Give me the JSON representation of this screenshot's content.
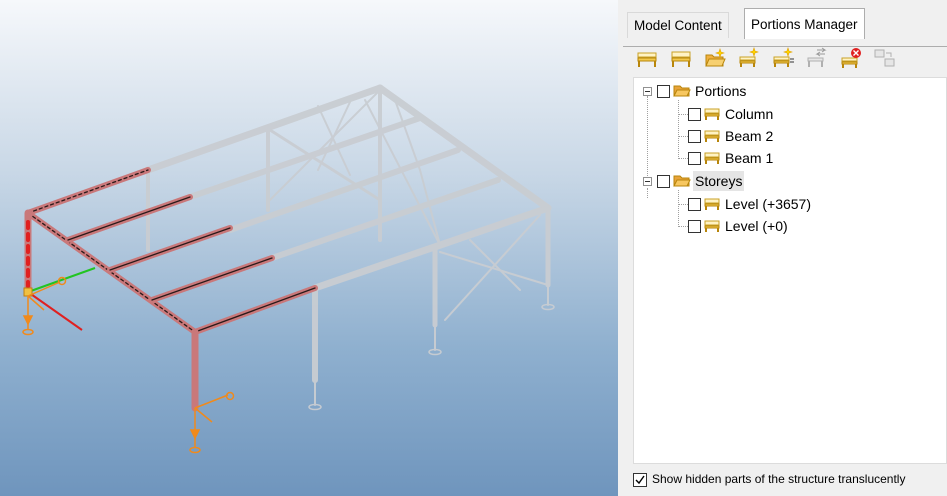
{
  "panel": {
    "tabs": [
      {
        "label": "Model Content",
        "active": false
      },
      {
        "label": "Portions Manager",
        "active": true
      }
    ],
    "toolbar": [
      "new-portion-icon",
      "edit-portion-icon",
      "new-folder-icon",
      "add-portion-icon",
      "add-level-icon",
      "move-portion-icon",
      "delete-portion-icon",
      "merge-portion-icon"
    ],
    "tree": {
      "portions": {
        "label": "Portions",
        "items": [
          "Column",
          "Beam 2",
          "Beam 1"
        ]
      },
      "storeys": {
        "label": "Storeys",
        "items": [
          "Level (+3657)",
          "Level (+0)"
        ]
      }
    },
    "footer": {
      "checkbox_label": "Show hidden parts of the structure translucently",
      "checked": true
    }
  },
  "colors": {
    "selected_member": "#c9787a",
    "hidden_member": "#c9cdd2",
    "axis_x": "#e02020",
    "axis_y": "#22c422",
    "support": "#f08a1c"
  }
}
